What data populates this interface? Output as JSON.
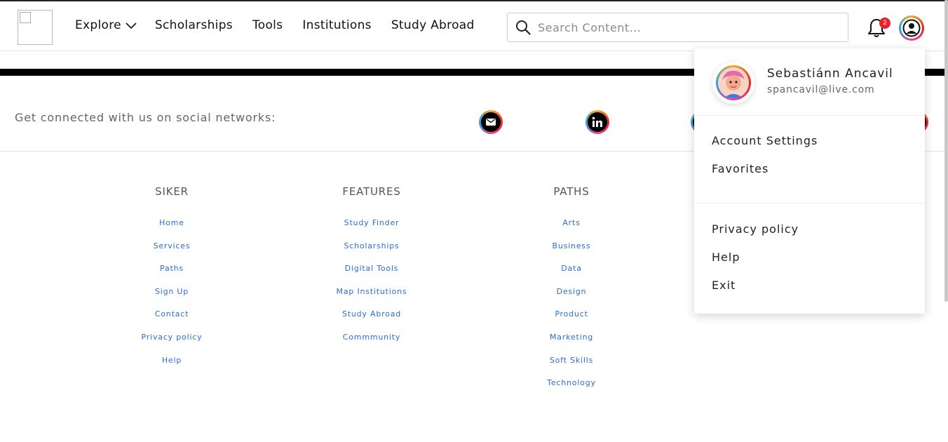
{
  "header": {
    "logo_alt": "",
    "nav": [
      {
        "label": "Explore",
        "has_dropdown": true
      },
      {
        "label": "Scholarships"
      },
      {
        "label": "Tools"
      },
      {
        "label": "Institutions"
      },
      {
        "label": "Study Abroad"
      }
    ],
    "search": {
      "placeholder": "Search Content...",
      "value": "",
      "icon": "search-icon"
    },
    "notifications": {
      "icon": "bell-icon",
      "count": "2"
    },
    "account": {
      "icon": "user-circle-icon"
    }
  },
  "social": {
    "text": "Get connected with us on social networks:",
    "icons": [
      "mail-icon",
      "linkedin-icon"
    ]
  },
  "footer": {
    "columns": [
      {
        "title": "SIKER",
        "links": [
          "Home",
          "Services",
          "Paths",
          "Sign Up",
          "Contact",
          "Privacy policy",
          "Help"
        ]
      },
      {
        "title": "FEATURES",
        "links": [
          "Study Finder",
          "Scholarships",
          "Digital Tools",
          "Map Institutions",
          "Study Abroad",
          "Commmunity"
        ]
      },
      {
        "title": "PATHS",
        "links": [
          "Arts",
          "Business",
          "Data",
          "Design",
          "Product",
          "Marketing",
          "Soft Skills",
          "Technology"
        ]
      }
    ]
  },
  "dropdown": {
    "user_name": "Sebastiánn Ancavil",
    "user_email": "spancavil@live.com",
    "group1": [
      "Account Settings",
      "Favorites"
    ],
    "group2": [
      "Privacy policy",
      "Help",
      "Exit"
    ]
  },
  "colors": {
    "link": "#2a6bd6",
    "badge": "#e8232a",
    "band": "#000000"
  }
}
